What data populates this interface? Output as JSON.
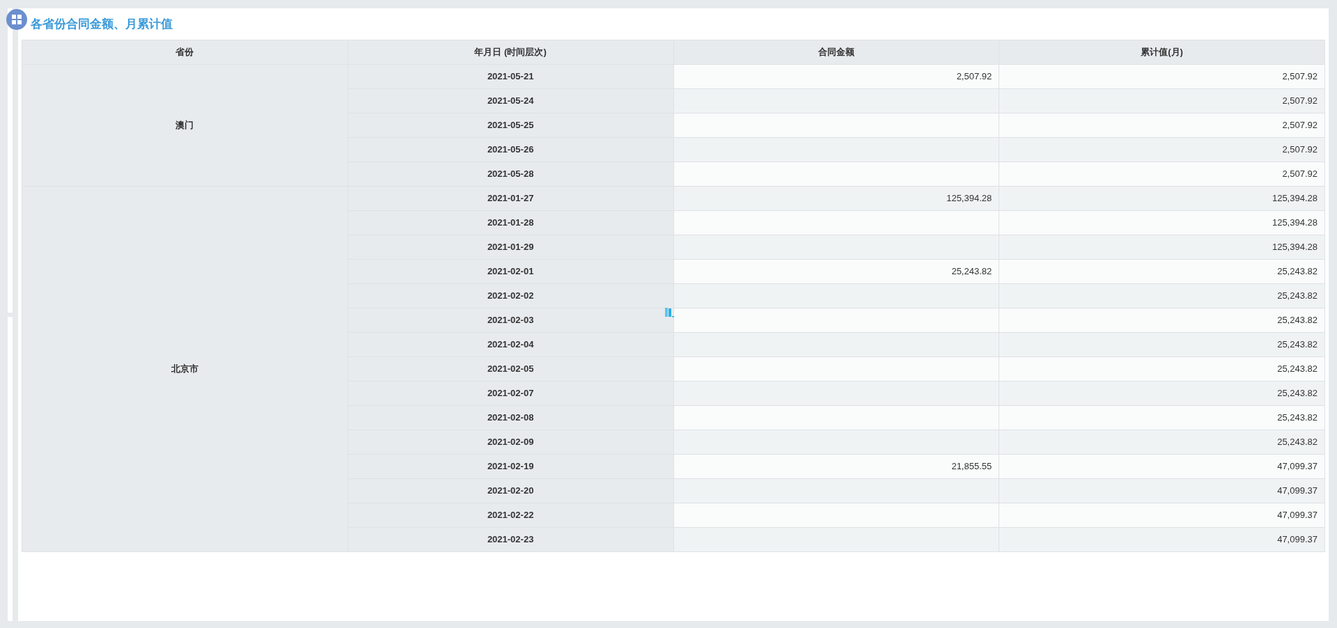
{
  "widget": {
    "title": "各省份合同金额、月累计值"
  },
  "table": {
    "columns": [
      "省份",
      "年月日 (时间层次)",
      "合同金额",
      "累计值(月)"
    ],
    "groups": [
      {
        "province": "澳门",
        "rows": [
          {
            "date": "2021-05-21",
            "amount": "2,507.92",
            "cumulative": "2,507.92"
          },
          {
            "date": "2021-05-24",
            "cumulative": "2,507.92"
          },
          {
            "date": "2021-05-25",
            "cumulative": "2,507.92"
          },
          {
            "date": "2021-05-26",
            "cumulative": "2,507.92"
          },
          {
            "date": "2021-05-28",
            "cumulative": "2,507.92"
          }
        ]
      },
      {
        "province": "北京市",
        "rows": [
          {
            "date": "2021-01-27",
            "amount": "125,394.28",
            "cumulative": "125,394.28"
          },
          {
            "date": "2021-01-28",
            "cumulative": "125,394.28"
          },
          {
            "date": "2021-01-29",
            "cumulative": "125,394.28"
          },
          {
            "date": "2021-02-01",
            "amount": "25,243.82",
            "cumulative": "25,243.82"
          },
          {
            "date": "2021-02-02",
            "cumulative": "25,243.82"
          },
          {
            "date": "2021-02-03",
            "cumulative": "25,243.82"
          },
          {
            "date": "2021-02-04",
            "cumulative": "25,243.82"
          },
          {
            "date": "2021-02-05",
            "cumulative": "25,243.82"
          },
          {
            "date": "2021-02-07",
            "cumulative": "25,243.82"
          },
          {
            "date": "2021-02-08",
            "cumulative": "25,243.82"
          },
          {
            "date": "2021-02-09",
            "cumulative": "25,243.82"
          },
          {
            "date": "2021-02-19",
            "amount": "21,855.55",
            "cumulative": "47,099.37"
          },
          {
            "date": "2021-02-20",
            "cumulative": "47,099.37"
          },
          {
            "date": "2021-02-22",
            "cumulative": "47,099.37"
          },
          {
            "date": "2021-02-23",
            "cumulative": "47,099.37"
          }
        ]
      }
    ]
  }
}
